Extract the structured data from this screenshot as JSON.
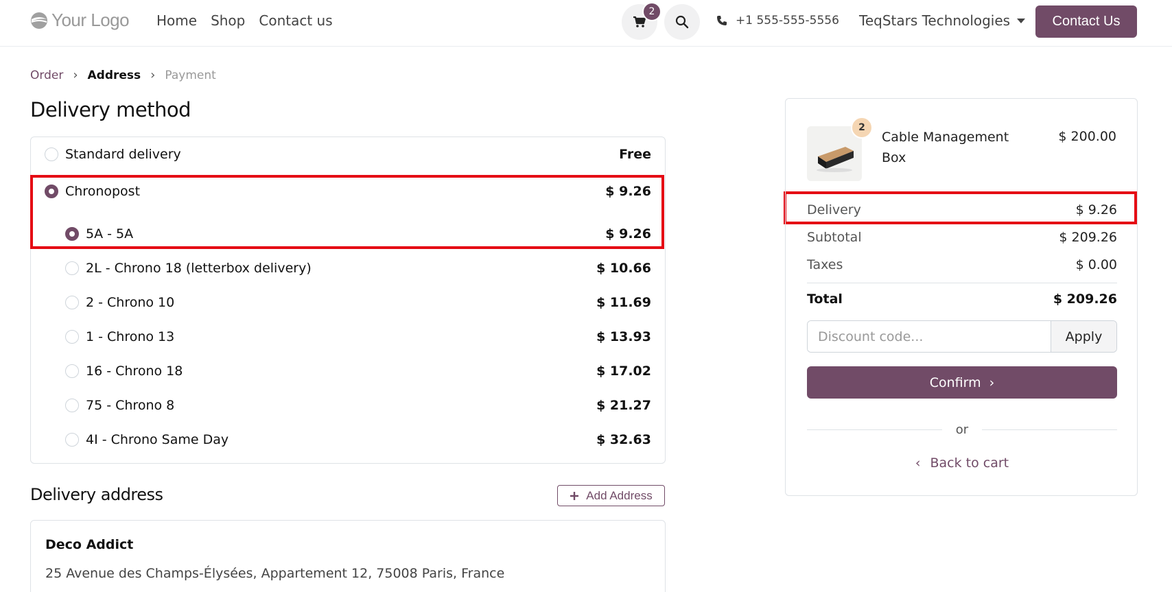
{
  "header": {
    "logo_text": "Your Logo",
    "nav": [
      "Home",
      "Shop",
      "Contact us"
    ],
    "cart_count": "2",
    "phone": "+1 555-555-5556",
    "company": "TeqStars Technologies",
    "contact_button": "Contact Us",
    "accent_color": "#714b67"
  },
  "breadcrumb": {
    "order": "Order",
    "address": "Address",
    "payment": "Payment"
  },
  "delivery_method": {
    "title": "Delivery method",
    "options": [
      {
        "label": "Standard delivery",
        "price": "Free",
        "selected": false
      },
      {
        "label": "Chronopost",
        "price": "$ 9.26",
        "selected": true
      }
    ],
    "sub_options": [
      {
        "label": "5A - 5A",
        "price": "$ 9.26",
        "selected": true
      },
      {
        "label": "2L - Chrono 18 (letterbox delivery)",
        "price": "$ 10.66",
        "selected": false
      },
      {
        "label": "2 - Chrono 10",
        "price": "$ 11.69",
        "selected": false
      },
      {
        "label": "1 - Chrono 13",
        "price": "$ 13.93",
        "selected": false
      },
      {
        "label": "16 - Chrono 18",
        "price": "$ 17.02",
        "selected": false
      },
      {
        "label": "75 - Chrono 8",
        "price": "$ 21.27",
        "selected": false
      },
      {
        "label": "4I - Chrono Same Day",
        "price": "$ 32.63",
        "selected": false
      }
    ]
  },
  "delivery_address": {
    "title": "Delivery address",
    "add_button": "Add Address",
    "name": "Deco Addict",
    "line": "25 Avenue des Champs-Élysées, Appartement 12, 75008 Paris, France"
  },
  "summary": {
    "product_name": "Cable Management Box",
    "product_qty": "2",
    "product_price": "$ 200.00",
    "delivery_label": "Delivery",
    "delivery_value": "$ 9.26",
    "subtotal_label": "Subtotal",
    "subtotal_value": "$ 209.26",
    "taxes_label": "Taxes",
    "taxes_value": "$ 0.00",
    "total_label": "Total",
    "total_value": "$ 209.26",
    "discount_placeholder": "Discount code...",
    "apply_button": "Apply",
    "confirm_button": "Confirm",
    "or_text": "or",
    "back_link": "Back to cart"
  }
}
